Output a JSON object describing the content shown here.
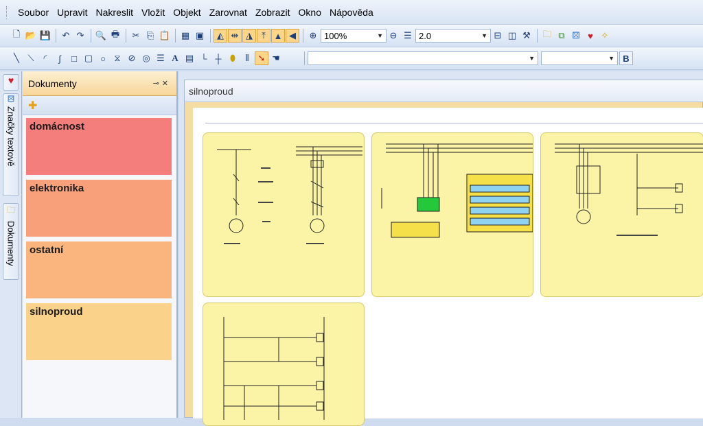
{
  "menu": [
    "Soubor",
    "Upravit",
    "Nakreslit",
    "Vložit",
    "Objekt",
    "Zarovnat",
    "Zobrazit",
    "Okno",
    "Nápověda"
  ],
  "toolbar1": {
    "zoom_value": "100%",
    "line_width_value": "2.0"
  },
  "toolbar2": {
    "font_value": "",
    "size_value": "",
    "bold_label": "B"
  },
  "side_tabs": {
    "symbols_label": "Značky textově",
    "documents_label": "Dokumenty"
  },
  "documents_panel": {
    "title": "Dokumenty",
    "items": [
      {
        "label": "domácnost",
        "color": "#f47e7c"
      },
      {
        "label": "elektronika",
        "color": "#f8a07a"
      },
      {
        "label": "ostatní",
        "color": "#fab57f"
      },
      {
        "label": "silnoproud",
        "color": "#fbd28a"
      }
    ]
  },
  "document_window": {
    "tab_title": "silnoproud"
  },
  "colors": {
    "page_fill": "#fbf3a6",
    "accent_orange": "#f7d699",
    "toolbar_blue": "#d5e2f3"
  }
}
